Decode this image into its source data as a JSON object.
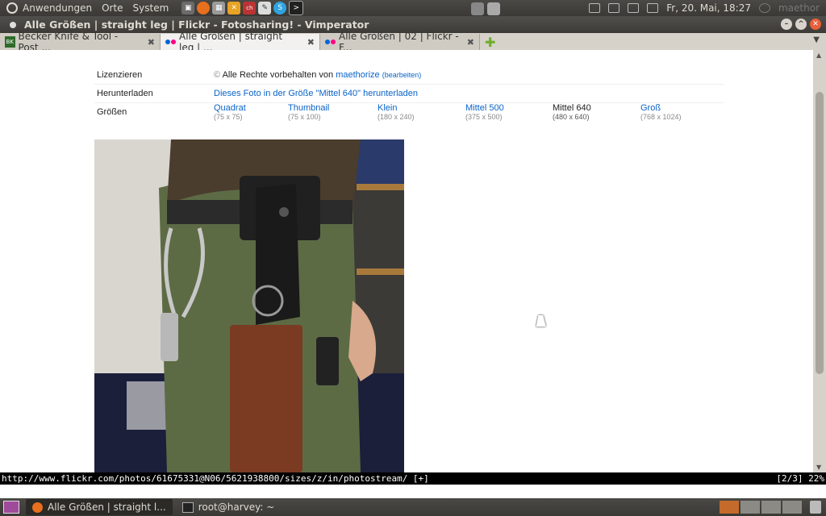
{
  "top_panel": {
    "menus": [
      "Anwendungen",
      "Orte",
      "System"
    ],
    "clock": "Fr, 20. Mai, 18:27",
    "user": "maethor"
  },
  "window": {
    "title": "Alle Größen | straight leg | Flickr - Fotosharing! - Vimperator"
  },
  "tabs": [
    {
      "label": "Becker Knife & Tool - Post ...",
      "active": false
    },
    {
      "label": "Alle Größen | straight leg | ...",
      "active": true
    },
    {
      "label": "Alle Größen | 02 | Flickr - F...",
      "active": false
    }
  ],
  "info": {
    "license_label": "Lizenzieren",
    "license_text": "Alle Rechte vorbehalten von",
    "license_user": "maethorize",
    "license_edit": "(bearbeiten)",
    "download_label": "Herunterladen",
    "download_link": "Dieses Foto in der Größe \"Mittel 640\" herunterladen",
    "sizes_label": "Größen",
    "sizes": [
      {
        "name": "Quadrat",
        "dims": "(75 x 75)",
        "current": false
      },
      {
        "name": "Thumbnail",
        "dims": "(75 x 100)",
        "current": false
      },
      {
        "name": "Klein",
        "dims": "(180 x 240)",
        "current": false
      },
      {
        "name": "Mittel 500",
        "dims": "(375 x 500)",
        "current": false
      },
      {
        "name": "Mittel 640",
        "dims": "(480 x 640)",
        "current": true
      },
      {
        "name": "Groß",
        "dims": "(768 x 1024)",
        "current": false
      }
    ]
  },
  "statusbar": {
    "url": "http://www.flickr.com/photos/61675331@N06/5621938800/sizes/z/in/photostream/ [+]",
    "position": "[2/3] 22%"
  },
  "bottom_panel": {
    "tasks": [
      "Alle Größen | straight l...",
      "root@harvey: ~"
    ]
  }
}
